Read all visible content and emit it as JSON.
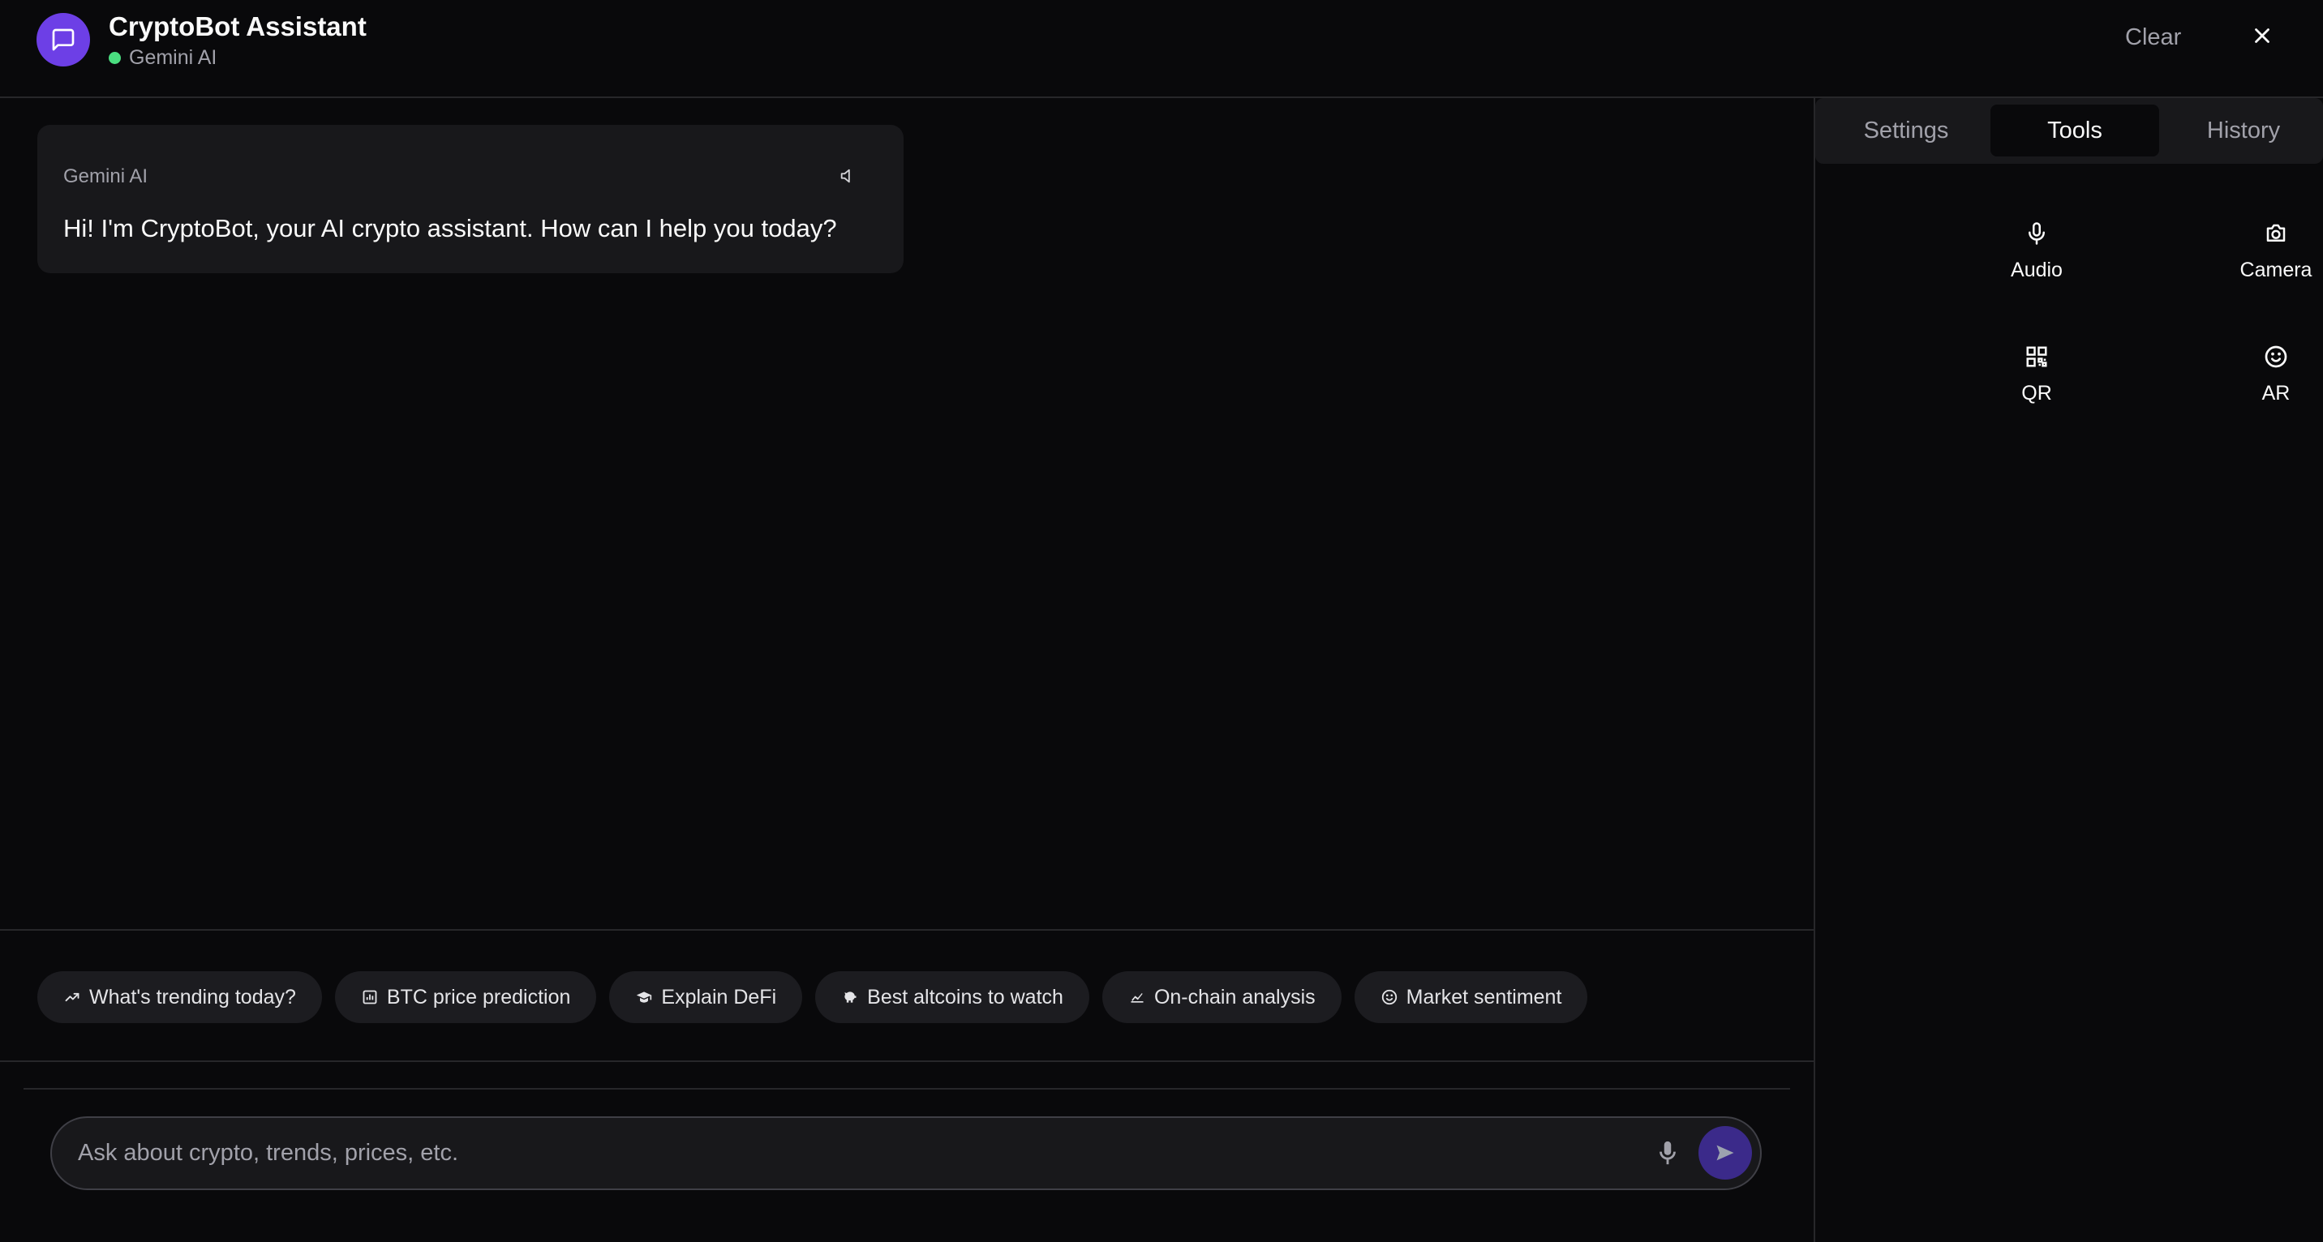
{
  "header": {
    "title": "CryptoBot Assistant",
    "status_label": "Gemini AI",
    "clear_label": "Clear",
    "icons": {
      "avatar": "chat-bubble-icon",
      "close": "close-icon"
    }
  },
  "chat": {
    "messages": [
      {
        "sender": "Gemini AI",
        "text": "Hi! I'm CryptoBot, your AI crypto assistant. How can I help you today?",
        "icon": "speaker-icon"
      }
    ]
  },
  "suggestions": [
    {
      "icon": "trending-up-icon",
      "label": "What's trending today?"
    },
    {
      "icon": "bar-chart-icon",
      "label": "BTC price prediction"
    },
    {
      "icon": "graduation-cap-icon",
      "label": "Explain DeFi"
    },
    {
      "icon": "piggy-bank-icon",
      "label": "Best altcoins to watch"
    },
    {
      "icon": "chain-analysis-icon",
      "label": "On-chain analysis"
    },
    {
      "icon": "smile-icon",
      "label": "Market sentiment"
    }
  ],
  "input": {
    "placeholder": "Ask about crypto, trends, prices, etc.",
    "value": "",
    "icons": {
      "mic": "microphone-icon",
      "send": "send-icon"
    }
  },
  "side_panel": {
    "tabs": [
      {
        "label": "Settings",
        "active": false
      },
      {
        "label": "Tools",
        "active": true
      },
      {
        "label": "History",
        "active": false
      }
    ],
    "tools": [
      {
        "label": "Audio",
        "icon": "microphone-icon"
      },
      {
        "label": "Camera",
        "icon": "camera-icon"
      },
      {
        "label": "QR",
        "icon": "qr-code-icon"
      },
      {
        "label": "AR",
        "icon": "smile-icon"
      }
    ]
  },
  "colors": {
    "background": "#09090b",
    "accent": "#6d3fe6",
    "status_online": "#4ade80",
    "surface": "#18181b",
    "border": "#27272a"
  }
}
